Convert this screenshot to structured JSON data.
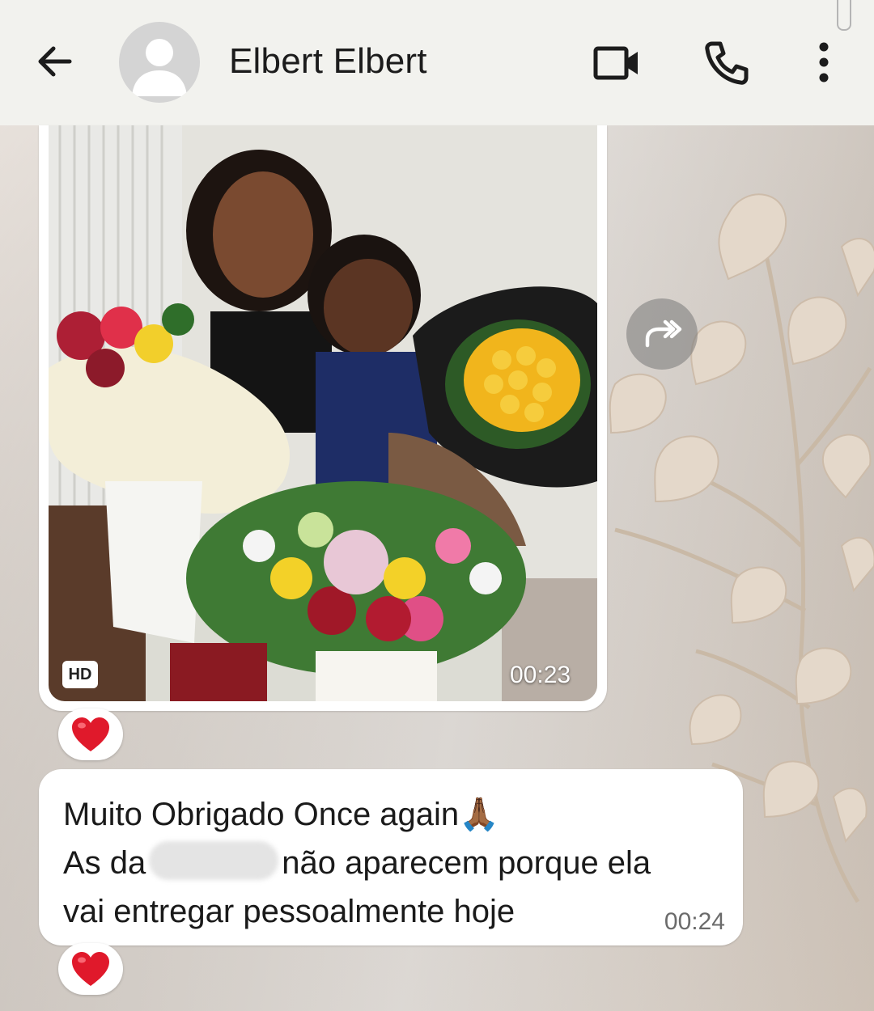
{
  "header": {
    "contact_name": "Elbert Elbert",
    "back_icon": "arrow-left-icon",
    "avatar_icon": "default-avatar-icon",
    "video_call_icon": "video-camera-icon",
    "voice_call_icon": "phone-icon",
    "menu_icon": "vertical-dots-icon"
  },
  "media_message": {
    "quality_badge": "HD",
    "duration": "00:23",
    "forward_icon": "forward-icon",
    "reaction": "❤️"
  },
  "text_message": {
    "line1": "Muito Obrigado Once again",
    "line1_emoji": "🙏🏾",
    "line2_start": "As da",
    "line2_end": "não aparecem porque ela",
    "line3": "vai entregar pessoalmente hoje",
    "time": "00:24",
    "reaction": "❤️"
  },
  "colors": {
    "header_bg": "#f2f2ee",
    "bubble_bg": "#ffffff",
    "icon_color": "#1c1c1c",
    "time_color": "#6b6b6b"
  }
}
